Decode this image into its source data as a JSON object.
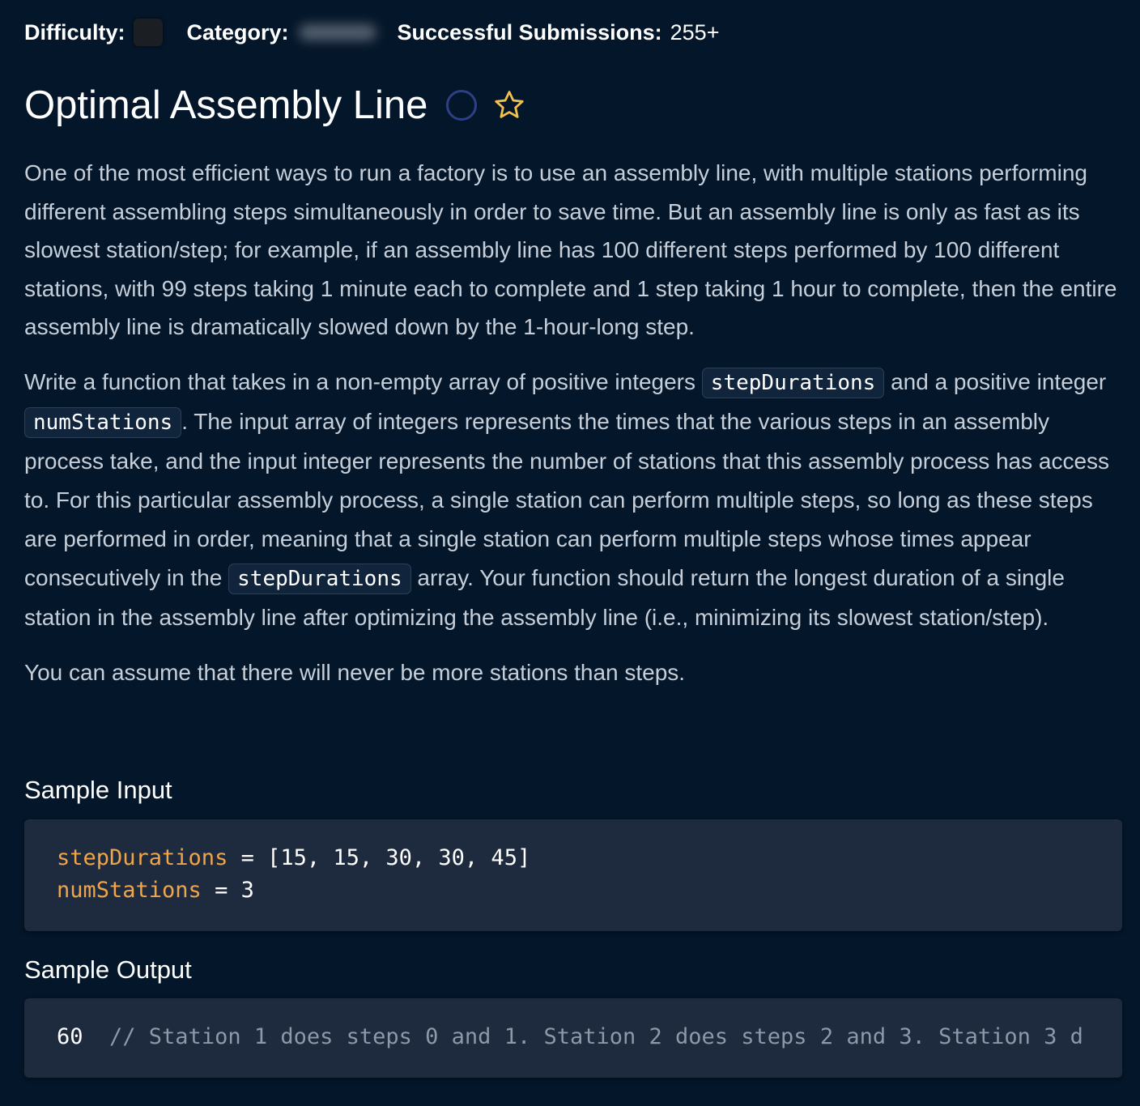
{
  "meta": {
    "difficulty_label": "Difficulty:",
    "category_label": "Category:",
    "submissions_label": "Successful Submissions:",
    "submissions_value": "255+"
  },
  "problem": {
    "title": "Optimal Assembly Line"
  },
  "prompt": {
    "p1": "One of the most efficient ways to run a factory is to use an assembly line, with multiple stations performing different assembling steps simultaneously in order to save time. But an assembly line is only as fast as its slowest station/step; for example, if an assembly line has 100 different steps performed by 100 different stations, with 99 steps taking 1 minute each to complete and 1 step taking 1 hour to complete, then the entire assembly line is dramatically slowed down by the 1-hour-long step.",
    "p2_a": "Write a function that takes in a non-empty array of positive integers ",
    "p2_code1": "stepDurations",
    "p2_b": " and a positive integer ",
    "p2_code2": "numStations",
    "p2_c": ". The input array of integers represents the times that the various steps in an assembly process take, and the input integer represents the number of stations that this assembly process has access to. For this particular assembly process, a single station can perform multiple steps, so long as these steps are performed in order, meaning that a single station can perform multiple steps whose times appear consecutively in the ",
    "p2_code3": "stepDurations",
    "p2_d": " array. Your function should return the longest duration of a single station in the assembly line after optimizing the assembly line (i.e., minimizing its slowest station/step).",
    "p3": "You can assume that there will never be more stations than steps."
  },
  "sample_input": {
    "heading": "Sample Input",
    "line1_var": "stepDurations",
    "line1_rest": " = [15, 15, 30, 30, 45]",
    "line2_var": "numStations",
    "line2_rest": " = 3"
  },
  "sample_output": {
    "heading": "Sample Output",
    "value": "60",
    "comment": "  // Station 1 does steps 0 and 1. Station 2 does steps 2 and 3. Station 3 d"
  },
  "icons": {
    "status": "circle-outline-icon",
    "favorite": "star-outline-icon"
  },
  "colors": {
    "background": "#041629",
    "code_block": "#1e2a3d",
    "variable": "#f0a54a",
    "comment": "#8c99a7",
    "star": "#f2c14e"
  }
}
